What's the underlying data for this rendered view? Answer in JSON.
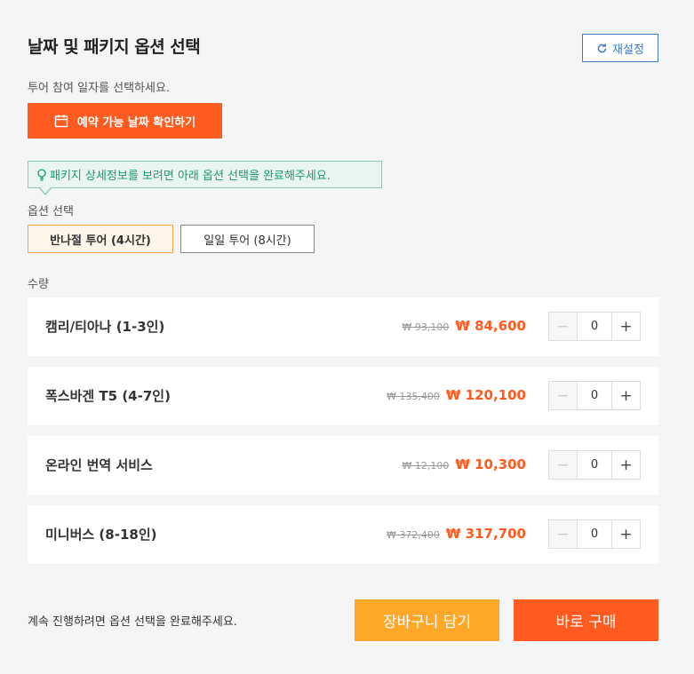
{
  "header": {
    "title": "날짜 및 패키지 옵션 선택",
    "reset_label": "재설정"
  },
  "date": {
    "instruction": "투어 참여 일자를 선택하세요.",
    "button_label": "예약 가능 날짜 확인하기"
  },
  "tooltip": {
    "text": "패키지 상세정보를 보려면 아래 옵션 선택을 완료해주세요."
  },
  "options": {
    "label": "옵션 선택",
    "items": [
      {
        "label": "반나절 투어 (4시간)",
        "selected": true
      },
      {
        "label": "일일 투어 (8시간)",
        "selected": false
      }
    ]
  },
  "quantity": {
    "label": "수량",
    "rows": [
      {
        "name": "캠리/티아나 (1-3인)",
        "old_price": "₩ 93,100",
        "price": "₩ 84,600",
        "qty": "0"
      },
      {
        "name": "폭스바겐 T5 (4-7인)",
        "old_price": "₩ 135,400",
        "price": "₩ 120,100",
        "qty": "0"
      },
      {
        "name": "온라인 번역 서비스",
        "old_price": "₩ 12,100",
        "price": "₩ 10,300",
        "qty": "0"
      },
      {
        "name": "미니버스 (8-18인)",
        "old_price": "₩ 372,400",
        "price": "₩ 317,700",
        "qty": "0"
      }
    ]
  },
  "footer": {
    "message": "계속 진행하려면 옵션 선택을 완료해주세요.",
    "cart_label": "장바구니 담기",
    "buy_label": "바로 구매"
  },
  "colors": {
    "accent": "#ff5a1f",
    "secondary": "#ffa726",
    "link": "#3d7bc7",
    "info": "#199a6f"
  }
}
